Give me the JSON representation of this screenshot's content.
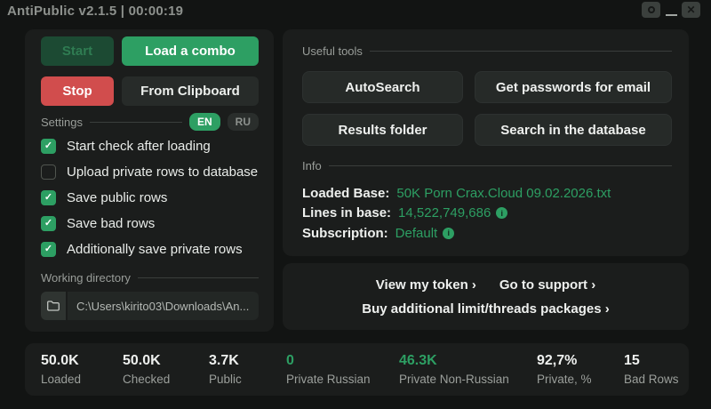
{
  "window": {
    "title": "AntiPublic v2.1.5 | 00:00:19",
    "controls": {
      "circle": "circle-icon",
      "minimize": "minimize-icon",
      "close_glyph": "✕"
    }
  },
  "left_panel": {
    "buttons": {
      "start": "Start",
      "load_combo": "Load a combo",
      "stop": "Stop",
      "from_clipboard": "From Clipboard"
    },
    "settings": {
      "label": "Settings",
      "lang_en": "EN",
      "lang_ru": "RU",
      "checkboxes": [
        {
          "label": "Start check after loading",
          "checked": true
        },
        {
          "label": "Upload private rows to database",
          "checked": false
        },
        {
          "label": "Save public rows",
          "checked": true
        },
        {
          "label": "Save bad rows",
          "checked": true
        },
        {
          "label": "Additionally save private rows",
          "checked": true
        }
      ]
    },
    "working_directory": {
      "label": "Working directory",
      "path": "C:\\Users\\kirito03\\Downloads\\An..."
    }
  },
  "tools_panel": {
    "label": "Useful tools",
    "buttons": {
      "autosearch": "AutoSearch",
      "get_passwords": "Get passwords for email",
      "results_folder": "Results folder",
      "search_db": "Search in the database"
    },
    "info": {
      "label": "Info",
      "rows": [
        {
          "label": "Loaded Base:",
          "value": "50K Porn Crax.Cloud 09.02.2026.txt",
          "info_icon": false
        },
        {
          "label": "Lines in base:",
          "value": "14,522,749,686",
          "info_icon": true
        },
        {
          "label": "Subscription:",
          "value": "Default",
          "info_icon": true
        }
      ],
      "info_icon_glyph": "i"
    }
  },
  "links_panel": {
    "view_token": "View my token ›",
    "support": "Go to support ›",
    "buy_packages": "Buy additional limit/threads packages ›"
  },
  "stats": [
    {
      "value": "50.0K",
      "label": "Loaded",
      "green": false
    },
    {
      "value": "50.0K",
      "label": "Checked",
      "green": false
    },
    {
      "value": "3.7K",
      "label": "Public",
      "green": false
    },
    {
      "value": "0",
      "label": "Private Russian",
      "green": true
    },
    {
      "value": "46.3K",
      "label": "Private Non-Russian",
      "green": true
    },
    {
      "value": "92,7%",
      "label": "Private, %",
      "green": false
    },
    {
      "value": "15",
      "label": "Bad Rows",
      "green": false
    }
  ],
  "colors": {
    "accent_green": "#2d9f63",
    "danger_red": "#d14d4d",
    "card_bg": "#1b1d1c",
    "page_bg": "#121413"
  }
}
